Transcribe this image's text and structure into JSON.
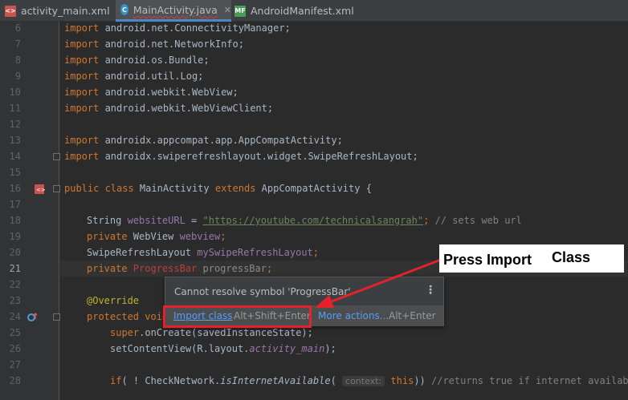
{
  "tabs": [
    {
      "label": "activity_main.xml",
      "icon": "xml-file-icon"
    },
    {
      "label": "MainActivity.java",
      "icon": "java-class-icon",
      "active": true
    },
    {
      "label": "AndroidManifest.xml",
      "icon": "manifest-file-icon"
    }
  ],
  "line_numbers": [
    "6",
    "7",
    "8",
    "9",
    "10",
    "11",
    "12",
    "13",
    "14",
    "15",
    "16",
    "17",
    "18",
    "19",
    "20",
    "21",
    "22",
    "23",
    "24",
    "25",
    "26",
    "27",
    "28"
  ],
  "current_line": "21",
  "code": {
    "l6": {
      "kw": "import",
      "rest": " android.net.ConnectivityManager;"
    },
    "l7": {
      "kw": "import",
      "rest": " android.net.NetworkInfo;"
    },
    "l8": {
      "kw": "import",
      "rest": " android.os.Bundle;"
    },
    "l9": {
      "kw": "import",
      "rest": " android.util.Log;"
    },
    "l10": {
      "kw": "import",
      "rest": " android.webkit.WebView;"
    },
    "l11": {
      "kw": "import",
      "rest": " android.webkit.WebViewClient;"
    },
    "l13": {
      "kw": "import",
      "rest": " androidx.appcompat.app.AppCompatActivity;"
    },
    "l14": {
      "kw": "import",
      "rest": " androidx.swiperefreshlayout.widget.SwipeRefreshLayout;"
    },
    "l16": {
      "kw1": "public class",
      "name": " MainActivity ",
      "kw2": "extends",
      "rest": " AppCompatActivity {"
    },
    "l18": {
      "type": "String ",
      "field": "websiteURL",
      "eq": " = ",
      "str": "\"https://youtube.com/technicalsangrah\"",
      "semi": "; ",
      "comment": "// sets web url"
    },
    "l19": {
      "kw": "private",
      "type": " WebView ",
      "field": "webview",
      "semi": ";"
    },
    "l20": {
      "type": "SwipeRefreshLayout ",
      "field": "mySwipeRefreshLayout",
      "semi": ";"
    },
    "l21": {
      "kw": "private",
      "err": " ProgressBar",
      "field": " progressBar",
      "semi": ";"
    },
    "l23": {
      "ann": "@Override"
    },
    "l24": {
      "kw": "protected void"
    },
    "l25": {
      "kw": "super",
      "rest": ".onCreate(savedInstanceState);"
    },
    "l26": {
      "pre": "setContentView(R.layout.",
      "ital": "activity_main",
      "post": ");"
    },
    "l28": {
      "kw": "if",
      "pre": "( ! CheckNetwork.",
      "ital": "isInternetAvailable",
      "open": "( ",
      "hint": "context:",
      "kw2": " this",
      "post": ")) ",
      "comment": "//returns true if internet available"
    }
  },
  "popup": {
    "message": "Cannot resolve symbol 'ProgressBar'",
    "import_label": "Import class",
    "import_shortcut": "Alt+Shift+Enter",
    "more_label": "More actions...",
    "more_shortcut": "Alt+Enter"
  },
  "callout": {
    "part1": "Press Import",
    "part2": "Class"
  },
  "colors": {
    "annotation_red": "#e5222c",
    "link_blue": "#589df6",
    "keyword_orange": "#cc7832"
  }
}
